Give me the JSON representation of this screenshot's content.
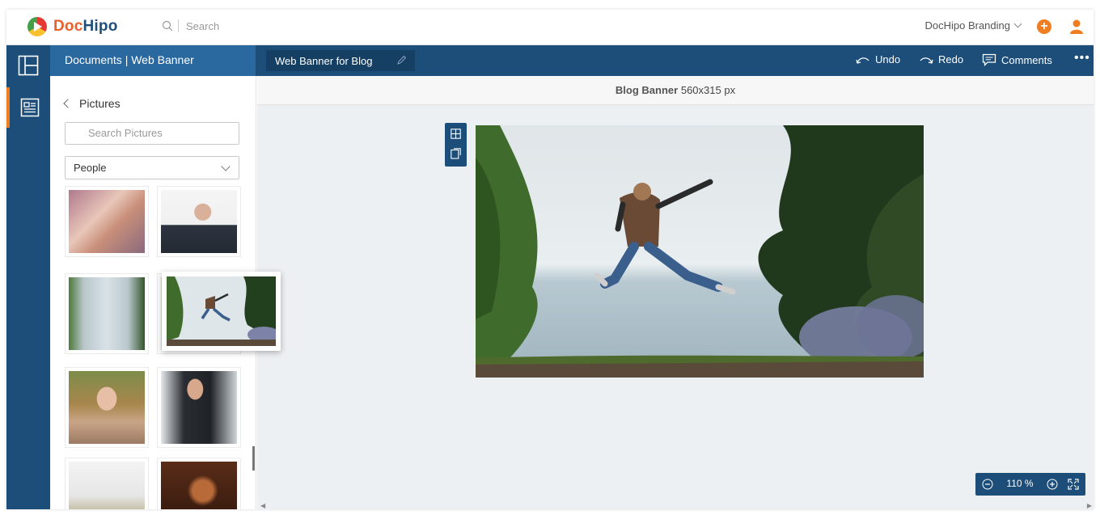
{
  "app": {
    "logo_doc": "Doc",
    "logo_hipo": "Hipo",
    "search_placeholder": "Search",
    "branding_label": "DocHipo Branding"
  },
  "header": {
    "breadcrumb": "Documents | Web Banner",
    "document_title": "Web Banner for Blog",
    "undo_label": "Undo",
    "redo_label": "Redo",
    "comments_label": "Comments"
  },
  "panel": {
    "title": "Pictures",
    "search_placeholder": "Search Pictures",
    "category": "People",
    "thumbnails": [
      {
        "name": "family-kiss"
      },
      {
        "name": "bald-man-smiling"
      },
      {
        "name": "jumping-girl"
      },
      {
        "name": "landscape-partial"
      },
      {
        "name": "woman-portrait"
      },
      {
        "name": "man-in-suit"
      },
      {
        "name": "foggy-field"
      },
      {
        "name": "man-warm-light"
      }
    ]
  },
  "canvas": {
    "size_name": "Blog Banner",
    "size_dims": "560x315 px",
    "zoom": "110 %"
  },
  "colors": {
    "primary": "#1d4e79",
    "accent": "#ef7d22",
    "canvas_bg": "#edf0f3"
  }
}
